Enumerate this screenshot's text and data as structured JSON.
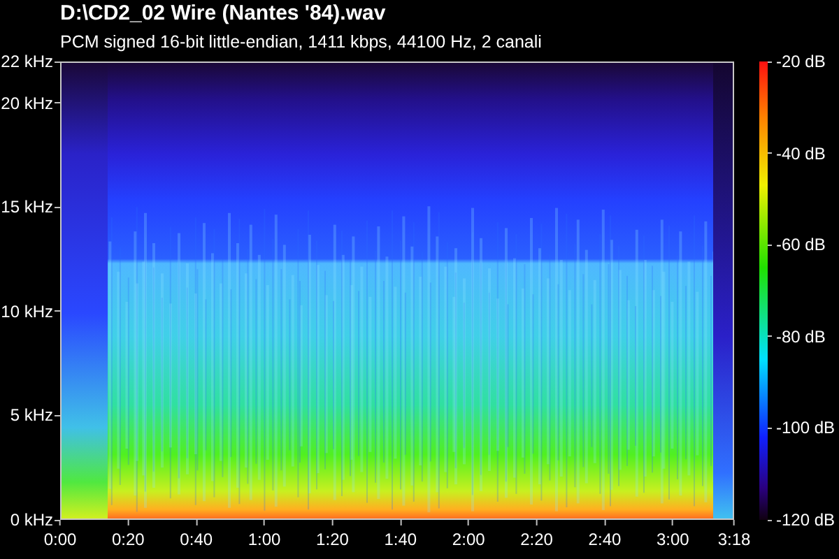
{
  "title": "D:\\CD2_02 Wire (Nantes '84).wav",
  "subtitle": "PCM signed 16-bit little-endian, 1411 kbps, 44100 Hz, 2 canali",
  "spectrogram": {
    "frequency_ticks": [
      "22 kHz",
      "20 kHz",
      "15 kHz",
      "10 kHz",
      "5 kHz",
      "0 kHz"
    ],
    "time_ticks": [
      "0:00",
      "0:20",
      "0:40",
      "1:00",
      "1:20",
      "1:40",
      "2:00",
      "2:20",
      "2:40",
      "3:00",
      "3:18"
    ],
    "level_ticks": [
      "-20 dB",
      "-40 dB",
      "-60 dB",
      "-80 dB",
      "-100 dB",
      "-120 dB"
    ]
  }
}
